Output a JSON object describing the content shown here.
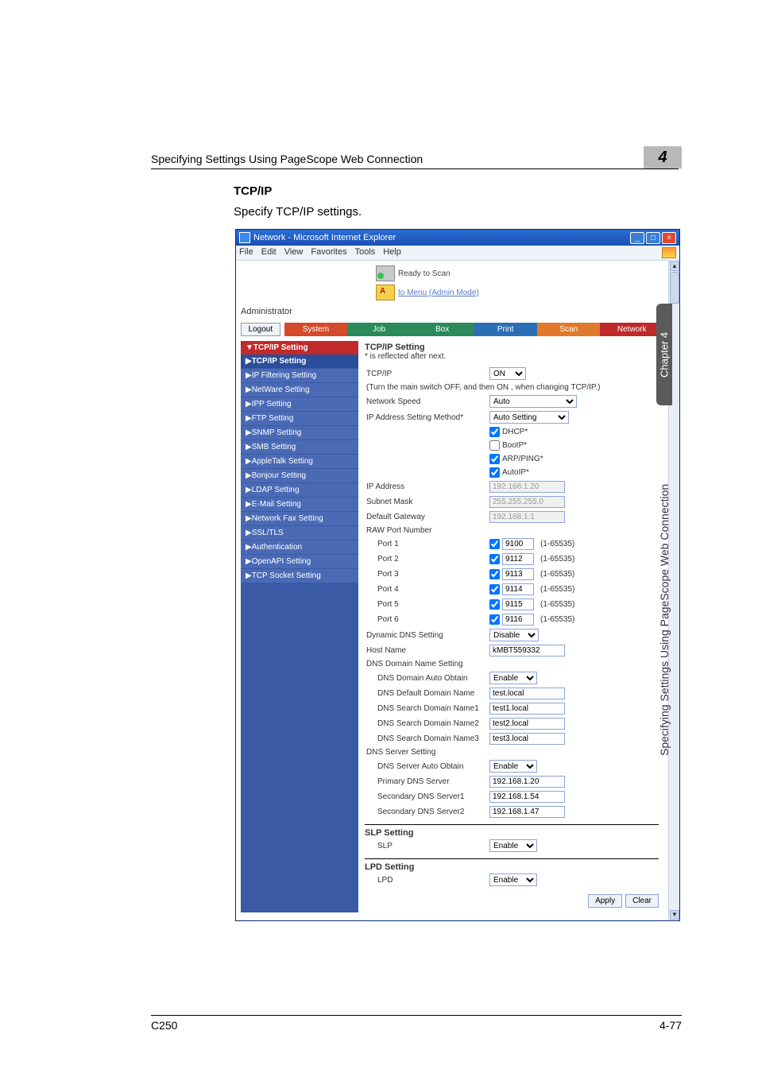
{
  "page": {
    "header": "Specifying Settings Using PageScope Web Connection",
    "header_number": "4",
    "section_title": "TCP/IP",
    "section_desc": "Specify TCP/IP settings.",
    "footer_left": "C250",
    "footer_right": "4-77",
    "side_tab": "Chapter 4",
    "side_caption": "Specifying Settings Using PageScope Web Connection"
  },
  "browser": {
    "title": "Network - Microsoft Internet Explorer",
    "menus": [
      "File",
      "Edit",
      "View",
      "Favorites",
      "Tools",
      "Help"
    ],
    "status_text": "Ready to Scan",
    "to_menu": "to Menu (Admin Mode)",
    "admin": "Administrator",
    "logout": "Logout",
    "tabs": {
      "system": "System",
      "job": "Job",
      "box": "Box",
      "print": "Print",
      "scan": "Scan",
      "network": "Network"
    }
  },
  "sidebar": {
    "header": "▼TCP/IP Setting",
    "sub": "▶TCP/IP Setting",
    "items": [
      "▶IP Filtering Setting",
      "▶NetWare Setting",
      "▶IPP Setting",
      "▶FTP Setting",
      "▶SNMP Setting",
      "▶SMB Setting",
      "▶AppleTalk Setting",
      "▶Bonjour Setting",
      "▶LDAP Setting",
      "▶E-Mail Setting",
      "▶Network Fax Setting",
      "▶SSL/TLS",
      "▶Authentication",
      "▶OpenAPI Setting",
      "▶TCP Socket Setting"
    ]
  },
  "form": {
    "group_title": "TCP/IP Setting",
    "note": "* is reflected after next.",
    "tcpip_label": "TCP/IP",
    "tcpip_value": "ON",
    "tcpip_hint": "(Turn the main switch OFF, and then ON , when changing TCP/IP.)",
    "netspeed_label": "Network Speed",
    "netspeed_value": "Auto",
    "ipmethod_label": "IP Address Setting Method*",
    "ipmethod_value": "Auto Setting",
    "dhcp_label": "DHCP*",
    "bootp_label": "BootP*",
    "arpping_label": "ARP/PING*",
    "autoip_label": "AutoIP*",
    "ipaddr_label": "IP Address",
    "ipaddr_value": "192.168.1.20",
    "subnet_label": "Subnet Mask",
    "subnet_value": "255.255.255.0",
    "gateway_label": "Default Gateway",
    "gateway_value": "192.168.1.1",
    "raw_label": "RAW Port Number",
    "ports": [
      {
        "label": "Port 1",
        "value": "9100",
        "range": "(1-65535)"
      },
      {
        "label": "Port 2",
        "value": "9112",
        "range": "(1-65535)"
      },
      {
        "label": "Port 3",
        "value": "9113",
        "range": "(1-65535)"
      },
      {
        "label": "Port 4",
        "value": "9114",
        "range": "(1-65535)"
      },
      {
        "label": "Port 5",
        "value": "9115",
        "range": "(1-65535)"
      },
      {
        "label": "Port 6",
        "value": "9116",
        "range": "(1-65535)"
      }
    ],
    "ddns_label": "Dynamic DNS Setting",
    "ddns_value": "Disable",
    "host_label": "Host Name",
    "host_value": "kMBT559332",
    "dns_domain_title": "DNS Domain Name Setting",
    "dns_domain_auto_label": "DNS Domain Auto Obtain",
    "dns_domain_auto_value": "Enable",
    "dns_default_label": "DNS Default Domain Name",
    "dns_default_value": "test.local",
    "dns_s1_label": "DNS Search Domain Name1",
    "dns_s1_value": "test1.local",
    "dns_s2_label": "DNS Search Domain Name2",
    "dns_s2_value": "test2.local",
    "dns_s3_label": "DNS Search Domain Name3",
    "dns_s3_value": "test3.local",
    "dns_server_title": "DNS Server Setting",
    "dns_server_auto_label": "DNS Server Auto Obtain",
    "dns_server_auto_value": "Enable",
    "dns_p_label": "Primary DNS Server",
    "dns_p_value": "192.168.1.20",
    "dns_sec1_label": "Secondary DNS Server1",
    "dns_sec1_value": "192.168.1.54",
    "dns_sec2_label": "Secondary DNS Server2",
    "dns_sec2_value": "192.168.1.47",
    "slp_title": "SLP Setting",
    "slp_label": "SLP",
    "slp_value": "Enable",
    "lpd_title": "LPD Setting",
    "lpd_label": "LPD",
    "lpd_value": "Enable",
    "apply": "Apply",
    "clear": "Clear"
  }
}
